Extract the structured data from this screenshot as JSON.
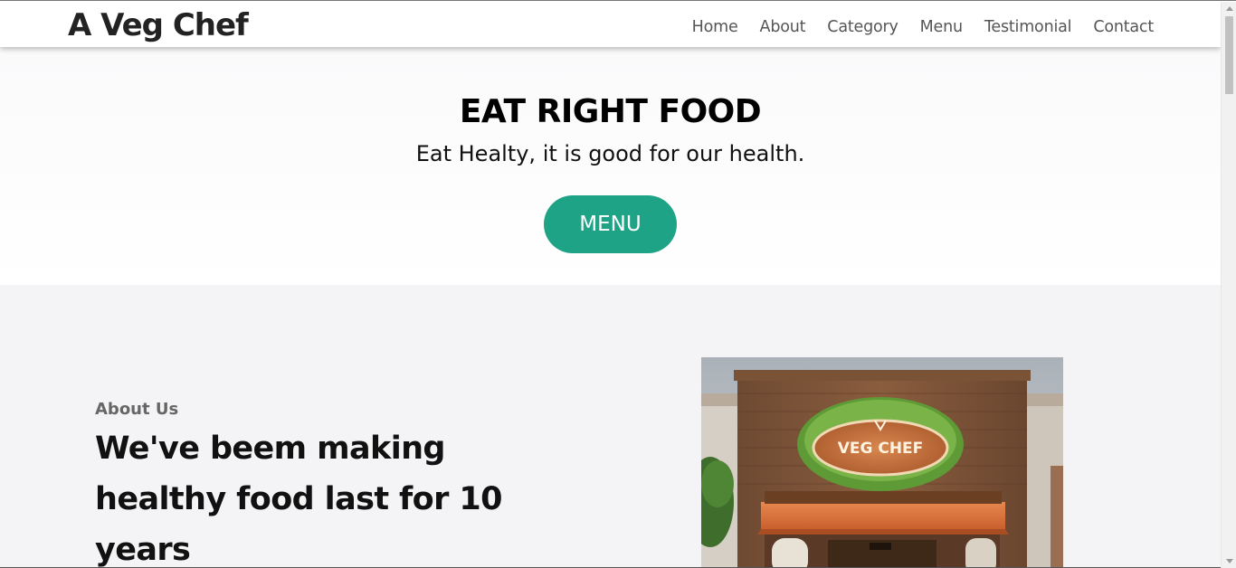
{
  "header": {
    "brand": "A Veg Chef",
    "nav": [
      "Home",
      "About",
      "Category",
      "Menu",
      "Testimonial",
      "Contact"
    ]
  },
  "hero": {
    "title": "EAT RIGHT FOOD",
    "subtitle": "Eat Healty, it is good for our health.",
    "button_label": "MENU"
  },
  "about": {
    "kicker": "About Us",
    "heading": "We've beem making healthy food last for 10 years",
    "image_sign_text": "VEG CHEF"
  },
  "colors": {
    "accent": "#1ea386",
    "brand_text": "#222222",
    "nav_text": "#555555",
    "section_bg": "#f4f4f6"
  }
}
